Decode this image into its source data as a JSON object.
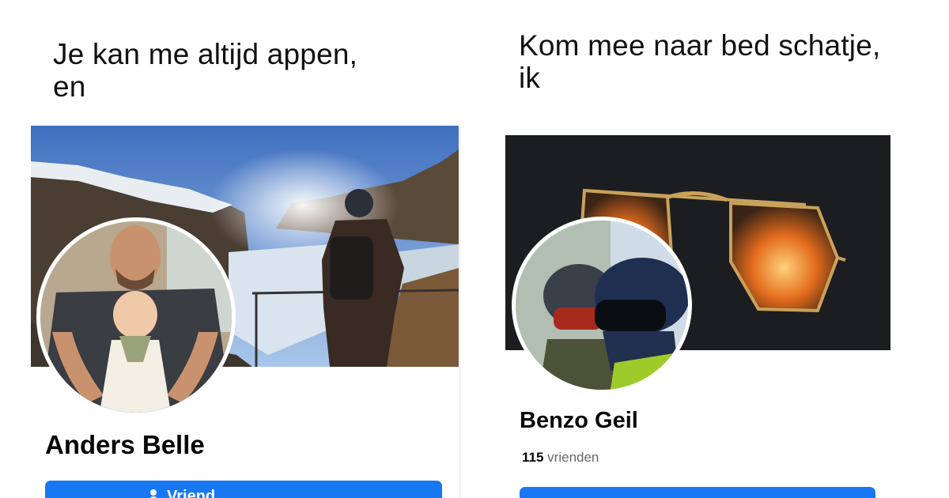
{
  "left": {
    "caption": "Je kan me altijd appen,\nen",
    "profile_name": "Anders Belle",
    "button_label": "Vriend"
  },
  "right": {
    "caption": "Kom mee naar bed schatje,\nik",
    "profile_name": "Benzo Geil",
    "friends_count": "115",
    "friends_label": "vrienden"
  },
  "colors": {
    "primary_button": "#1877f2",
    "name_text": "#050505",
    "secondary_text": "#65676b"
  }
}
